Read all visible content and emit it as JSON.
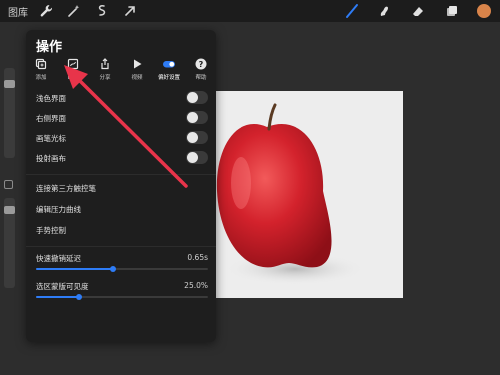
{
  "toolbar": {
    "gallery_label": "图库",
    "tools": [
      "wrench-icon",
      "magic-wand-icon",
      "selection-icon",
      "transform-arrow-icon",
      "brush-icon",
      "smudge-icon",
      "eraser-icon",
      "layers-icon",
      "color-swatch"
    ],
    "color_swatch": "#d9844a",
    "brush_color": "#2e7cf6"
  },
  "panel": {
    "title": "操作",
    "tabs": [
      {
        "label": "添加",
        "icon": "add-icon"
      },
      {
        "label": "画布",
        "icon": "canvas-icon"
      },
      {
        "label": "分享",
        "icon": "share-icon"
      },
      {
        "label": "视频",
        "icon": "video-play-icon"
      },
      {
        "label": "偏好设置",
        "icon": "preferences-toggle-icon",
        "active": true
      },
      {
        "label": "帮助",
        "icon": "help-icon"
      }
    ],
    "toggles": [
      {
        "label": "浅色界面",
        "on": false
      },
      {
        "label": "右侧界面",
        "on": false
      },
      {
        "label": "画笔光标",
        "on": false
      },
      {
        "label": "投射画布",
        "on": false
      }
    ],
    "links": [
      "连接第三方触控笔",
      "编辑压力曲线",
      "手势控制"
    ],
    "sliders": [
      {
        "label": "快速撤销延迟",
        "value_text": "0.65s",
        "fraction": 0.45
      },
      {
        "label": "选区蒙版可见度",
        "value_text": "25.0%",
        "fraction": 0.25
      }
    ]
  },
  "annotation": {
    "color": "#e8344a"
  },
  "accent_color": "#2e7cf6"
}
